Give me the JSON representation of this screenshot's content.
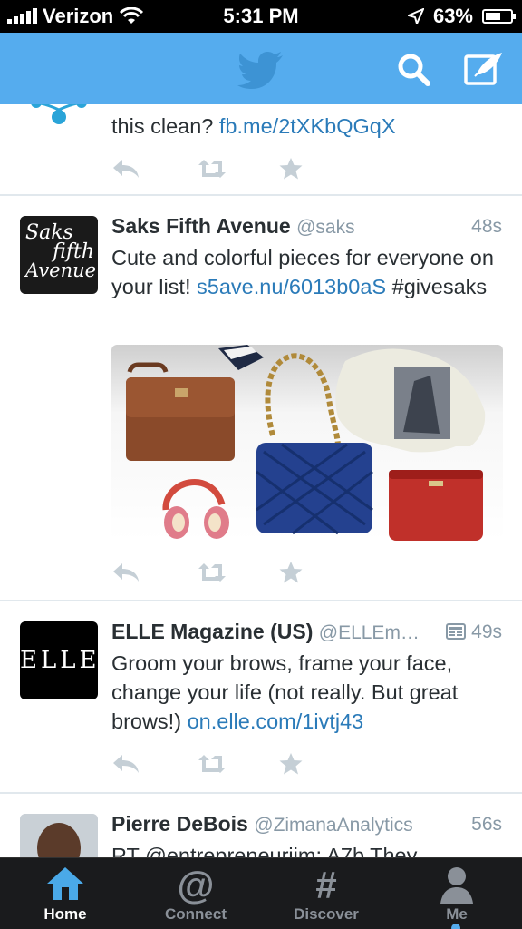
{
  "status_bar": {
    "carrier": "Verizon",
    "time": "5:31 PM",
    "battery": "63%",
    "battery_level": 0.63
  },
  "nav": {
    "logo_icon": "twitter-bird-icon",
    "search_icon": "search-icon",
    "compose_icon": "compose-icon"
  },
  "tweets": [
    {
      "text_prefix": "this clean? ",
      "link": "fb.me/2tXKbQGqX"
    },
    {
      "name": "Saks Fifth Avenue",
      "handle": "@saks",
      "time": "48s",
      "avatar_text": [
        "Saks",
        "fifth",
        "Avenue"
      ],
      "text_prefix": "Cute and colorful pieces for everyone on your list! ",
      "link": "s5ave.nu/6013b0aS",
      "text_suffix": " #givesaks"
    },
    {
      "name": "ELLE Magazine (US)",
      "handle": "@ELLEm…",
      "time": "49s",
      "avatar_text": "ELLE",
      "text_prefix": "Groom your brows, frame your face, change your life (not really. But great brows!) ",
      "link": "on.elle.com/1ivtj43"
    },
    {
      "name": "Pierre DeBois",
      "handle": "@ZimanaAnalytics",
      "time": "56s",
      "text_prefix": "RT @entrepreneurjim: A7b They"
    }
  ],
  "tab_bar": {
    "tabs": [
      {
        "label": "Home",
        "icon": "home-icon",
        "active": true
      },
      {
        "label": "Connect",
        "icon": "at-icon",
        "active": false
      },
      {
        "label": "Discover",
        "icon": "hash-icon",
        "active": false
      },
      {
        "label": "Me",
        "icon": "person-icon",
        "active": false
      }
    ]
  },
  "colors": {
    "brand": "#55acee",
    "link": "#2b7bb9",
    "muted": "#8899a6"
  }
}
